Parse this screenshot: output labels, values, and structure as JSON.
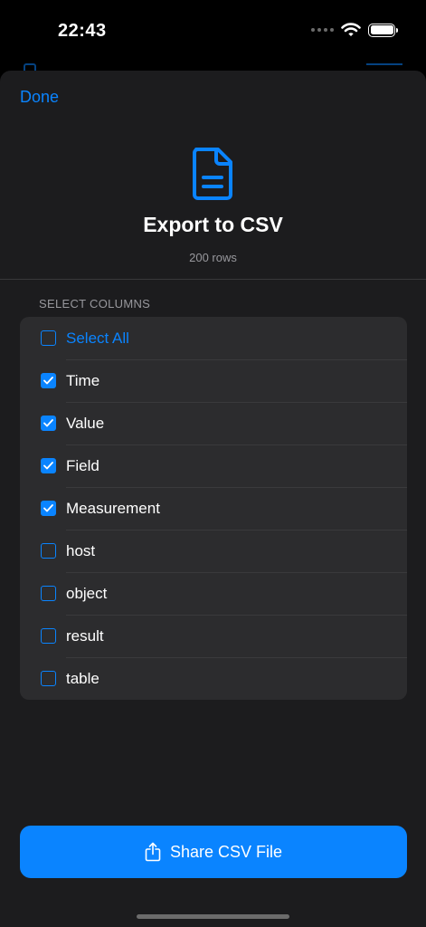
{
  "status_bar": {
    "time": "22:43"
  },
  "sheet": {
    "done_label": "Done",
    "title": "Export to CSV",
    "subtitle": "200 rows",
    "section_label": "SELECT COLUMNS",
    "select_all_label": "Select All",
    "columns": [
      {
        "label": "Time",
        "checked": true
      },
      {
        "label": "Value",
        "checked": true
      },
      {
        "label": "Field",
        "checked": true
      },
      {
        "label": "Measurement",
        "checked": true
      },
      {
        "label": "host",
        "checked": false
      },
      {
        "label": "object",
        "checked": false
      },
      {
        "label": "result",
        "checked": false
      },
      {
        "label": "table",
        "checked": false
      }
    ],
    "share_label": "Share CSV File"
  },
  "icons": {
    "header": "document-icon",
    "share": "share-icon",
    "wifi": "wifi-icon",
    "battery": "battery-icon"
  },
  "colors": {
    "accent": "#0a84ff",
    "sheet_bg": "#1c1c1e",
    "list_bg": "#2c2c2e"
  }
}
